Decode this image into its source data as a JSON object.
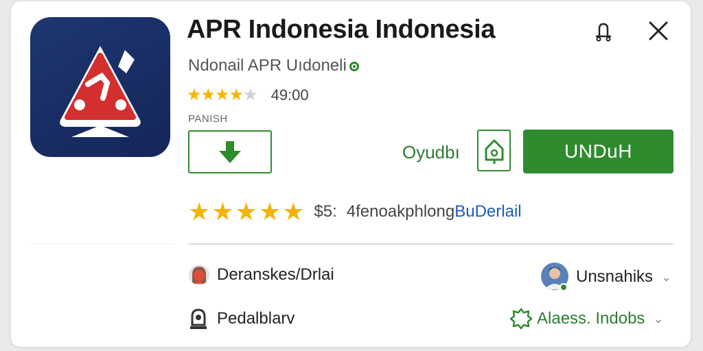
{
  "app": {
    "title": "APR Indonesia Indonesia",
    "developer": "Ndonail  APR Uıdoneli",
    "rating_value": "49:00",
    "badge": "PANISH",
    "stars_filled": 4,
    "stars_total": 5
  },
  "actions": {
    "secondary_link": "Oyudbı",
    "install_label": "UNDuH"
  },
  "reviews": {
    "score": "$5:",
    "text": "4fenoakphlong",
    "link": "BuDerlail"
  },
  "meta": {
    "left_top": "Deranskes/Drlai",
    "left_bottom": "Pedalblarv",
    "right_top": "Unsnahiks",
    "right_bottom": "Alaess. Indobs"
  },
  "icons": {
    "app": "red-triangle-logo-icon",
    "share": "bell-share-icon",
    "close": "close-icon",
    "download": "download-arrow-icon",
    "home": "home-icon",
    "verified": "verified-dot-icon",
    "user1": "avatar-red-icon",
    "user2": "avatar-photo-icon",
    "privacy": "lock-person-icon",
    "access": "gear-badge-icon",
    "chevron": "chevron-down-icon"
  },
  "colors": {
    "accent": "#2e8b2e",
    "star": "#f4b400",
    "link": "#1e5bb8",
    "icon_bg": "#1f3670",
    "logo_red": "#d32f2f"
  }
}
